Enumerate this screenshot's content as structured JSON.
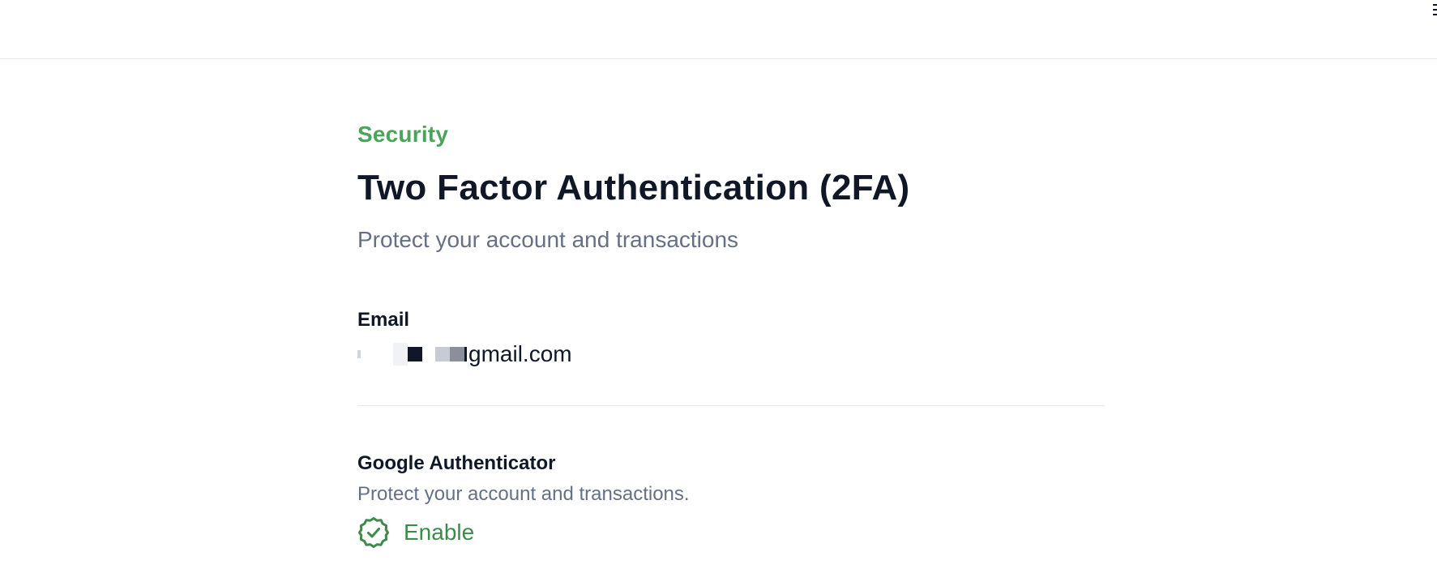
{
  "header": {
    "edge_icon": "menu-icon"
  },
  "security": {
    "section_label": "Security",
    "title": "Two Factor Authentication (2FA)",
    "subtitle": "Protect your account and transactions"
  },
  "email": {
    "label": "Email",
    "value_visible_suffix": "gmail.com",
    "value_redacted": true
  },
  "google_authenticator": {
    "title": "Google Authenticator",
    "description": "Protect your account and transactions.",
    "status": "Enable",
    "status_icon": "check-badge-icon",
    "status_color": "#3e8a4a"
  },
  "colors": {
    "accent": "#4aa55a",
    "text_primary": "#101828",
    "text_secondary": "#667085",
    "divider": "#e4e7ec"
  }
}
